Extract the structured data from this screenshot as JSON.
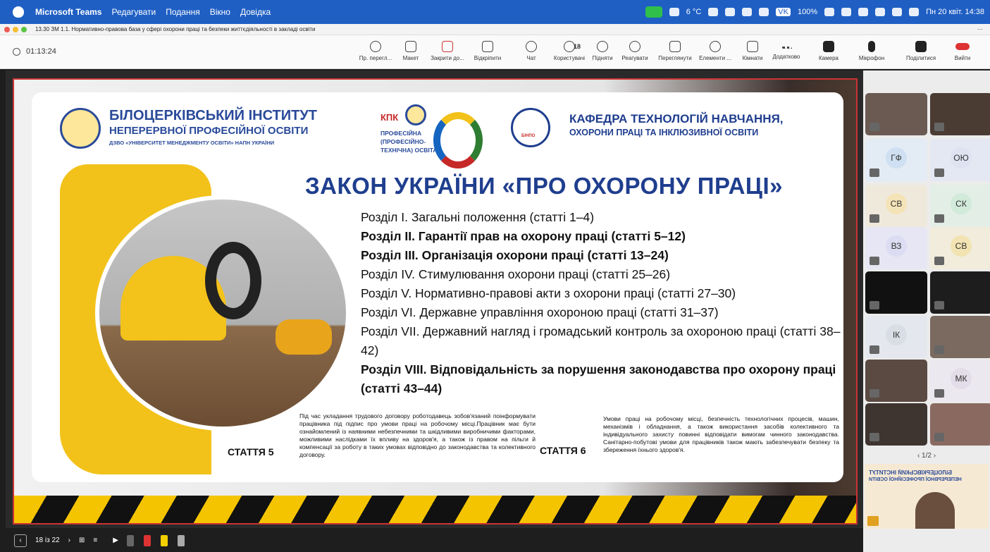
{
  "menubar": {
    "app": "Microsoft Teams",
    "items": [
      "Редагувати",
      "Подання",
      "Вікно",
      "Довідка"
    ],
    "weather": "6 °C",
    "vk": "VK",
    "battery": "100%",
    "clock": "Пн 20 квіт. 14:38"
  },
  "window": {
    "title": "13.30 ЗМ 1.1. Нормативно-правова база у сфері охорони праці та безпеки життєдіяльності в закладі освіти",
    "more": "···"
  },
  "toolbar": {
    "timer": "01:13:24",
    "buttons": [
      "Пр. перегл...",
      "Макет",
      "Закрити до...",
      "Відкріпити",
      "Чат",
      "Користувачі",
      "Підняти",
      "Реагувати",
      "Переглянути",
      "Елементи ...",
      "Кімнати",
      "Додатково",
      "Камера",
      "Мікрофон",
      "Поділитися",
      "Вийти"
    ],
    "users_count": "18"
  },
  "slide": {
    "inst_name_1": "БІЛОЦЕРКІВСЬКИЙ ІНСТИТУТ",
    "inst_name_2": "НЕПЕРЕРВНОЇ ПРОФЕСІЙНОЇ ОСВІТИ",
    "inst_sub": "ДЗВО «УНІВЕРСИТЕТ МЕНЕДЖМЕНТУ ОСВІТИ» НАПН УКРАЇНИ",
    "kpk_logo": "КПК",
    "kpk_lines": [
      "ПРОФЕСІЙНА",
      "(ПРОФЕСІЙНО-",
      "ТЕХНІЧНА) ОСВІТА"
    ],
    "dept_badge": "БІНПО",
    "dept_1": "КАФЕДРА ТЕХНОЛОГІЙ НАВЧАННЯ,",
    "dept_2": "ОХОРОНИ ПРАЦІ ТА ІНКЛЮЗИВНОЇ ОСВІТИ",
    "law_title": "ЗАКОН УКРАЇНИ «ПРО ОХОРОНУ ПРАЦІ»",
    "sections": [
      "Розділ I. Загальні положення (статті 1–4)",
      "Розділ II. Гарантії прав на охорону праці (статті 5–12)",
      "Розділ III. Організація охорони праці (статті 13–24)",
      "Розділ IV. Стимулювання охорони праці (статті 25–26)",
      "Розділ V. Нормативно-правові акти з охорони праці (статті 27–30)",
      "Розділ VI. Державне управління охороною праці (статті 31–37)",
      "Розділ VII. Державний нагляд і громадський контроль за охороною праці (статті 38–42)",
      "Розділ VIII. Відповідальність за порушення законодавства про охорону праці (статті 43–44)"
    ],
    "art5_label": "СТАТТЯ 5",
    "art5_text": "Під час укладання трудового договору роботодавець зобов'язаний поінформувати працівника під підпис про умови праці на робочому місці.Працівник має бути ознайомлений із наявними небезпечними та шкідливими виробничими факторами, можливими наслідками їх впливу на здоров'я, а також із правом на пільги й компенсації за роботу в таких умовах відповідно до законодавства та колективного договору.",
    "art6_label": "СТАТТЯ 6",
    "art6_text": "Умови праці на робочому місці, безпечність технологічних процесів, машин, механізмів і обладнання, а також використання засобів колективного та індивідуального захисту повинні відповідати вимогам чинного законодавства. Санітарно-побутові умови для працівників також мають забезпечувати безпеку та збереження їхнього здоров'я."
  },
  "slidenav": {
    "page": "18 із 22"
  },
  "participants": {
    "initials": [
      "ГФ",
      "ОЮ",
      "СВ",
      "СК",
      "ВЗ",
      "СВ",
      "ІК",
      "МК"
    ],
    "pager": "1/2",
    "banner_1": "БІЛОЦЕРКІВСЬКИЙ ІНСТИТУТ",
    "banner_2": "НЕПЕРЕРВНОЇ ПРОФЕСІЙНОЇ ОСВІТИ"
  }
}
